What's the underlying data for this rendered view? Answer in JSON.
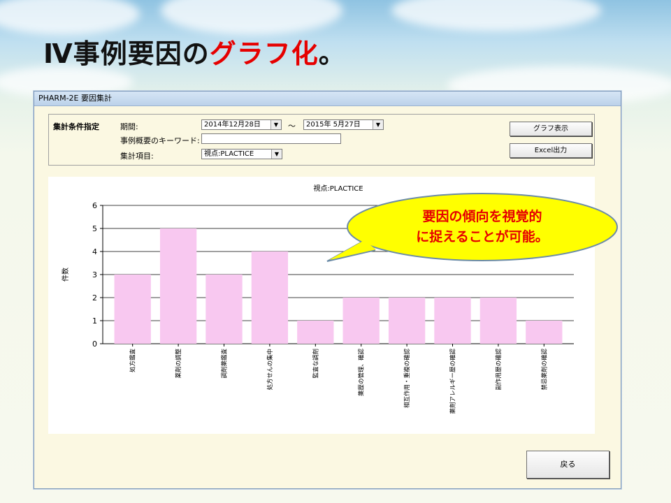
{
  "slide": {
    "title_prefix": "Ⅳ事例要因の",
    "title_accent": "グラフ化",
    "title_suffix": "。",
    "accent_color": "#e60000"
  },
  "window": {
    "title": "PHARM-2E 要因集計",
    "criteria": {
      "group_label": "集計条件指定",
      "period_label": "期間:",
      "period_from": "2014年12月28日",
      "period_sep": "～",
      "period_to": "2015年 5月27日",
      "keyword_label": "事例概要のキーワード:",
      "keyword_value": "",
      "item_label": "集計項目:",
      "item_value": "視点:PLACTICE"
    },
    "buttons": {
      "graph": "グラフ表示",
      "excel": "Excel出力",
      "back": "戻る"
    }
  },
  "callout": {
    "line1": "要因の傾向を視覚的",
    "line2": "に捉えることが可能。",
    "fill": "#ffff00",
    "text_color": "#e60000"
  },
  "chart_data": {
    "type": "bar",
    "title": "視点:PLACTICE",
    "ylabel": "件数",
    "xlabel": "",
    "ylim": [
      0,
      6
    ],
    "yticks": [
      0,
      1,
      2,
      3,
      4,
      5,
      6
    ],
    "categories": [
      "処方鑑査",
      "薬剤の調整",
      "調剤薬鑑査",
      "処方せんの集中",
      "監査な調剤",
      "薬歴の管理、確認",
      "相互作用・重複の確認",
      "薬剤アレルギー歴の確認",
      "副作用歴の確認",
      "禁忌薬剤の確認"
    ],
    "values": [
      3,
      5,
      3,
      4,
      1,
      2,
      2,
      2,
      2,
      1
    ],
    "bar_color": "#f8c8f0",
    "grid": true
  }
}
